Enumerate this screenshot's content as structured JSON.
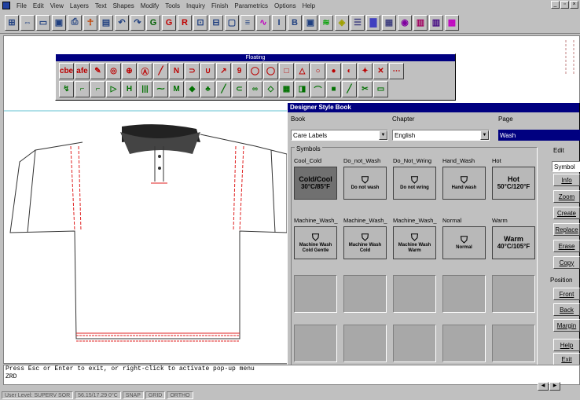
{
  "menu": [
    "File",
    "Edit",
    "View",
    "Layers",
    "Text",
    "Shapes",
    "Modify",
    "Tools",
    "Inquiry",
    "Finish",
    "Parametrics",
    "Options",
    "Help"
  ],
  "window_controls": [
    "_",
    "▫",
    "×"
  ],
  "toolbar_icons": [
    "ruler-icon",
    "open-icon",
    "save-icon",
    "disk-icon",
    "print-icon",
    "figure-icon",
    "window-icon",
    "undo-icon",
    "redo-icon",
    "g-icon",
    "g-red-icon",
    "r-icon",
    "select-icon",
    "grid-icon",
    "view-icon",
    "list-icon",
    "wave-icon",
    "i-icon",
    "b-icon",
    "box-icon",
    "stripes-icon",
    "palette-icon",
    "lines-icon",
    "fill-icon",
    "frame-icon",
    "circle-icon",
    "bars-icon",
    "bars2-icon",
    "pattern-icon"
  ],
  "floating": {
    "title": "Floating",
    "row1": [
      "cbe",
      "afe",
      "✎",
      "◎",
      "⊕",
      "Ⓐ",
      "╱",
      "N",
      "⊃",
      "∪",
      "↗",
      "9",
      "◯",
      "◯",
      "□",
      "△",
      "○",
      "●",
      "◐",
      "✦",
      "✕",
      "⋯"
    ],
    "row2": [
      "↯",
      "⌐",
      "⌐",
      "▷",
      "H",
      "|||",
      "⁓",
      "M",
      "◆",
      "♣",
      "╱",
      "⊂",
      "∞",
      "◇",
      "▦",
      "◨",
      "⌒",
      "■",
      "╱",
      "✂",
      "▭"
    ]
  },
  "dialog": {
    "title": "Designer Style Book",
    "book_label": "Book",
    "book_value": "Care Labels",
    "chapter_label": "Chapter",
    "chapter_value": "English",
    "page_label": "Page",
    "page_value": "Wash",
    "symbols_label": "Symbols",
    "edit_label": "Edit",
    "edit_combo": "Symbol",
    "edit_buttons": [
      "Info",
      "Zoom",
      "Create",
      "Replace",
      "Erase",
      "Copy"
    ],
    "position_label": "Position",
    "position_buttons": [
      "Front",
      "Back",
      "Margin"
    ],
    "help_button": "Help",
    "exit_button": "Exit",
    "row1": [
      {
        "name": "Cool_Cold",
        "line1": "Cold/Cool",
        "line2": "30°C/85°F"
      },
      {
        "name": "Do_not_Wash",
        "line1": "",
        "line2": "Do not wash"
      },
      {
        "name": "Do_Not_Wring",
        "line1": "",
        "line2": "Do not wring"
      },
      {
        "name": "Hand_Wash",
        "line1": "",
        "line2": "Hand wash"
      },
      {
        "name": "Hot",
        "line1": "Hot",
        "line2": "50°C/120°F"
      }
    ],
    "row2": [
      {
        "name": "Machine_Wash_",
        "line1": "",
        "line2": "Machine Wash Cold Gentle"
      },
      {
        "name": "Machine_Wash_",
        "line1": "",
        "line2": "Machine Wash Cold"
      },
      {
        "name": "Machine_Wash_",
        "line1": "",
        "line2": "Machine Wash Warm"
      },
      {
        "name": "Normal",
        "line1": "",
        "line2": "Normal"
      },
      {
        "name": "Warm",
        "line1": "Warm",
        "line2": "40°C/105°F"
      }
    ]
  },
  "command_line": "Press Esc or Enter to exit, or right-click to activate pop-up menu",
  "command_echo": "ZRD",
  "status": [
    "User Level: SUPERV SOR",
    "56.15/17.29 0°C",
    "SNAP",
    "GRID",
    "ORTHO"
  ],
  "colors": {
    "titlebar": "#000080",
    "face": "#c0c0c0",
    "pattern_red": "#e02020"
  }
}
